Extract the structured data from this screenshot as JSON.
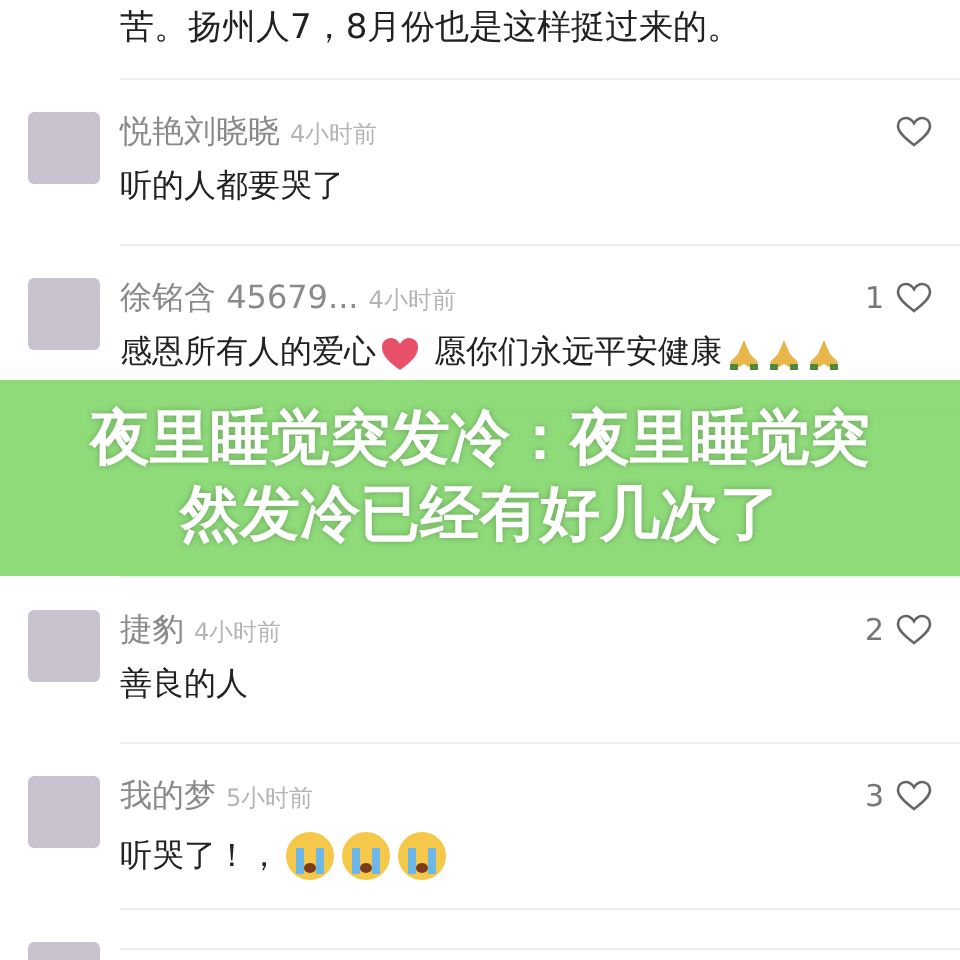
{
  "top_text": "苦。扬州人7，8月份也是这样挺过来的。",
  "comments": [
    {
      "kind": "comment",
      "name": "悦艳刘晓晓",
      "time": "4小时前",
      "content": [
        {
          "kind": "text",
          "text": "听的人都要哭了"
        }
      ]
    },
    {
      "kind": "comment",
      "name": "徐铭含 45679...",
      "time": "4小时前",
      "likes": "1",
      "content": [
        {
          "kind": "text",
          "text": "感恩所有人的爱心"
        },
        {
          "kind": "heart"
        },
        {
          "kind": "text",
          "text": " 愿你们永远平安健康"
        },
        {
          "kind": "pray"
        },
        {
          "kind": "pray"
        },
        {
          "kind": "pray"
        }
      ]
    },
    {
      "kind": "hidden"
    },
    {
      "kind": "comment",
      "name": "捷豹",
      "time": "4小时前",
      "likes": "2",
      "content": [
        {
          "kind": "text",
          "text": "善良的人"
        }
      ]
    },
    {
      "kind": "comment",
      "name": "我的梦",
      "time": "5小时前",
      "likes": "3",
      "content": [
        {
          "kind": "text",
          "text": "听哭了！，"
        },
        {
          "kind": "cry"
        },
        {
          "kind": "cry"
        },
        {
          "kind": "cry"
        }
      ]
    },
    {
      "kind": "cut"
    }
  ],
  "banner": {
    "title": "夜里睡觉突发冷：夜里睡觉突然发冷已经有好几次了"
  }
}
